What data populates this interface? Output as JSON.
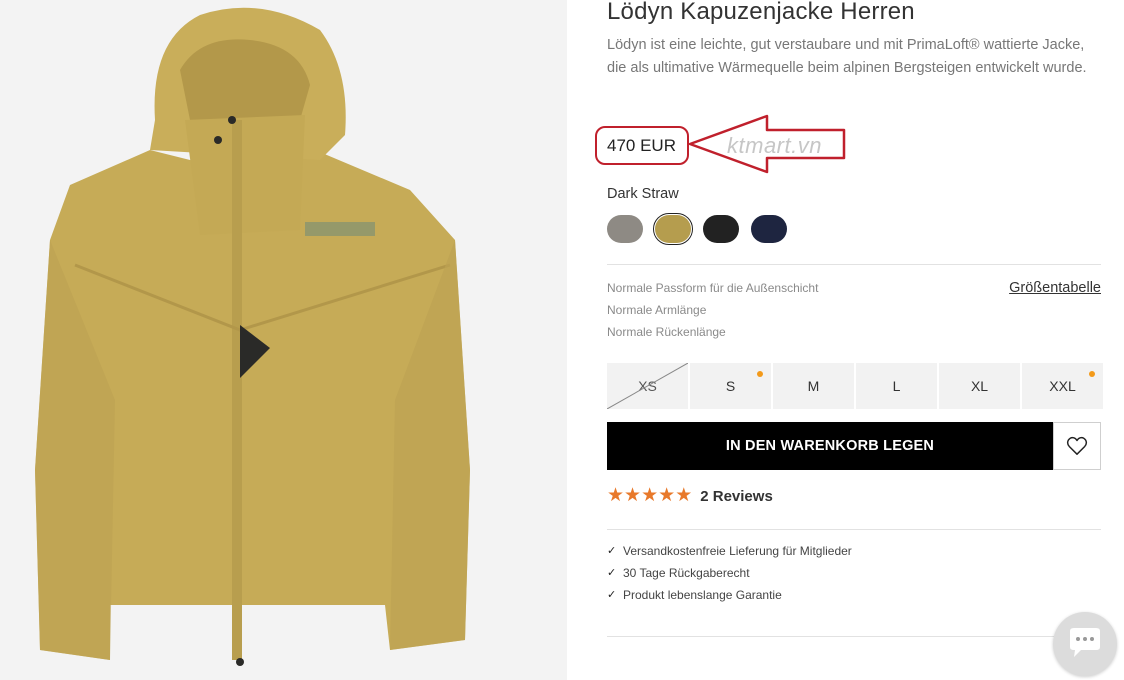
{
  "product": {
    "title": "Lödyn Kapuzenjacke Herren",
    "description": "Lödyn ist eine leichte, gut verstaubare und mit PrimaLoft® wattierte Jacke, die als ultimative Wärmequelle beim alpinen Bergsteigen entwickelt wurde.",
    "price": "470 EUR",
    "watermark": "ktmart.vn",
    "selected_color": "Dark Straw",
    "colors": [
      {
        "name": "grey",
        "hex": "#8e8a84"
      },
      {
        "name": "dark-straw",
        "hex": "#b59d4e",
        "selected": true
      },
      {
        "name": "black",
        "hex": "#222222"
      },
      {
        "name": "navy",
        "hex": "#1e2540"
      }
    ]
  },
  "fit": {
    "items": [
      "Normale Passform für die Außenschicht",
      "Normale Armlänge",
      "Normale Rückenlänge"
    ],
    "size_chart_label": "Größentabelle"
  },
  "sizes": [
    {
      "label": "XS",
      "available": false,
      "low_stock": false
    },
    {
      "label": "S",
      "available": true,
      "low_stock": true
    },
    {
      "label": "M",
      "available": true,
      "low_stock": false
    },
    {
      "label": "L",
      "available": true,
      "low_stock": false
    },
    {
      "label": "XL",
      "available": true,
      "low_stock": false
    },
    {
      "label": "XXL",
      "available": true,
      "low_stock": true
    }
  ],
  "actions": {
    "add_to_cart": "IN DEN WARENKORB LEGEN",
    "wishlist_icon": "heart-icon"
  },
  "rating": {
    "stars": 5,
    "reviews_label": "2 Reviews"
  },
  "usps": [
    "Versandkostenfreie Lieferung für Mitglieder",
    "30 Tage Rückgaberecht",
    "Produkt lebenslange Garantie"
  ],
  "colors": {
    "accent_orange": "#e8792b",
    "annotation_red": "#c0202c",
    "button_black": "#000000"
  }
}
